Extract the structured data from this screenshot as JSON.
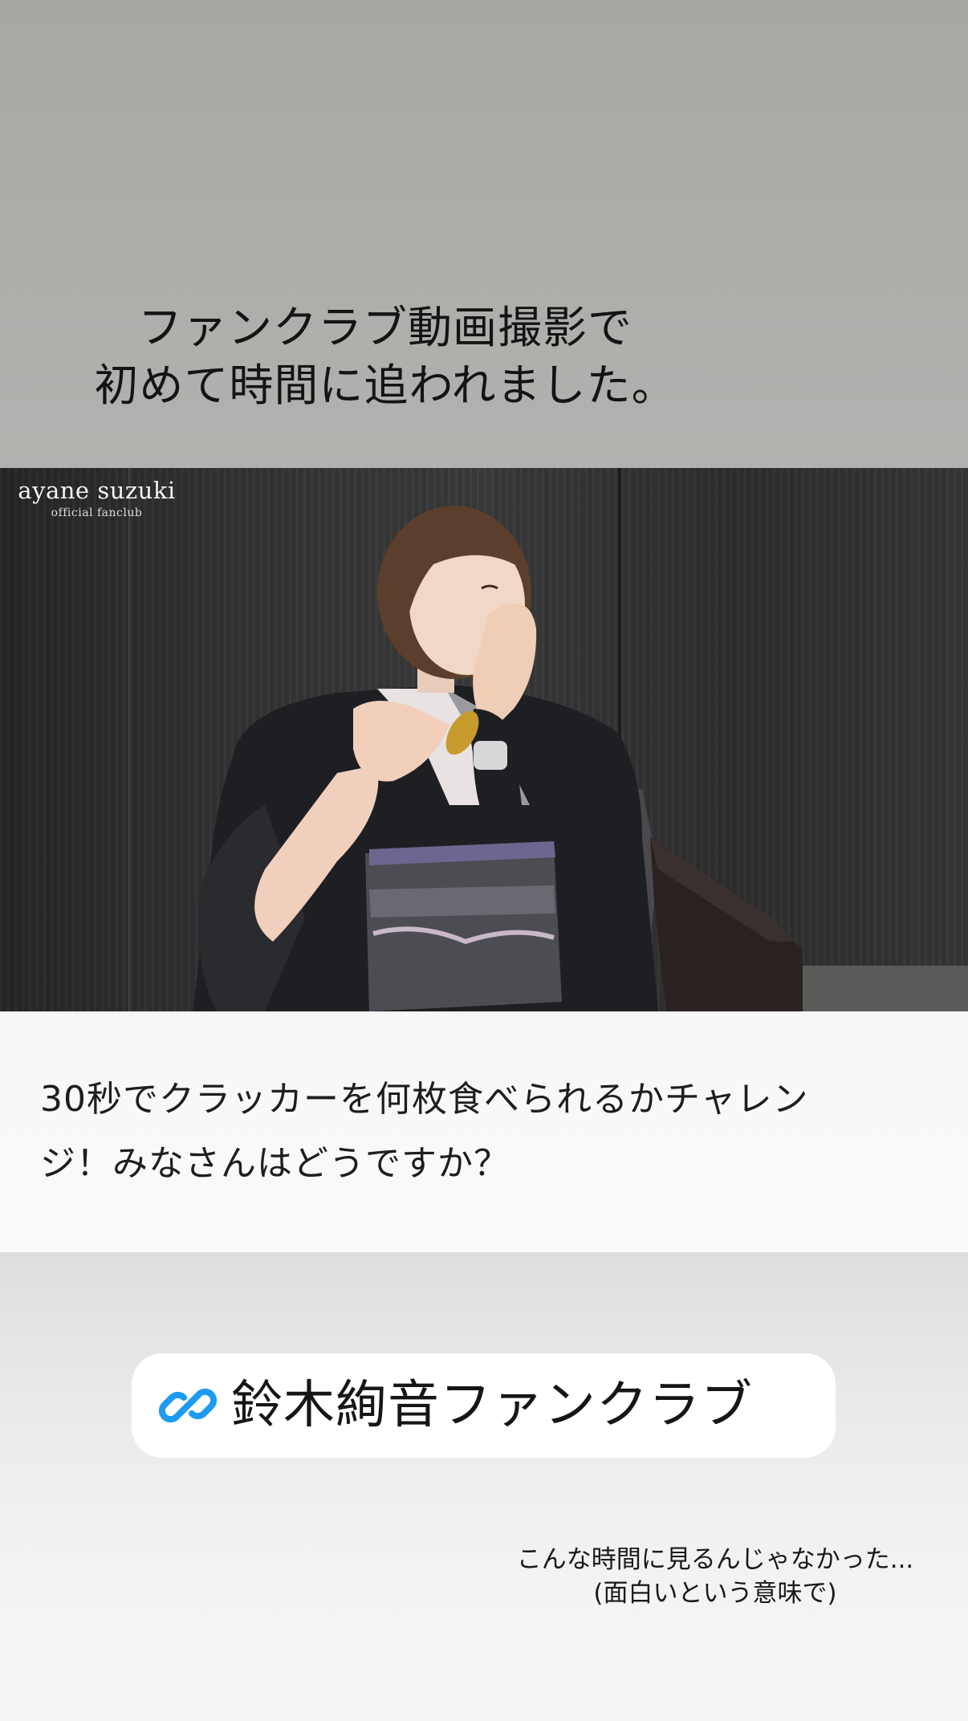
{
  "story": {
    "headline": {
      "line1": "ファンクラブ動画撮影で",
      "line2": "初めて時間に追われました。"
    },
    "video": {
      "brand_name": "ayane suzuki",
      "brand_sub": "official fanclub"
    },
    "caption": {
      "line1": "30秒でクラッカーを何枚食べられるかチャレン",
      "line2": "ジ！みなさんはどうですか？"
    },
    "link_sticker": {
      "icon": "link-icon",
      "label": "鈴木絢音ファンクラブ"
    },
    "comment": {
      "line1": "こんな時間に見るんじゃなかった...",
      "line2": "(面白いという意味で)"
    }
  },
  "colors": {
    "top_band": "#a9aba7",
    "video_bg": "#2f2f2f",
    "caption_bg": "#f8f8f8",
    "bottom_band": "#e8e8e8",
    "link_icon": "#1d9bf0",
    "sticker_bg": "#ffffff",
    "text": "#141414"
  }
}
